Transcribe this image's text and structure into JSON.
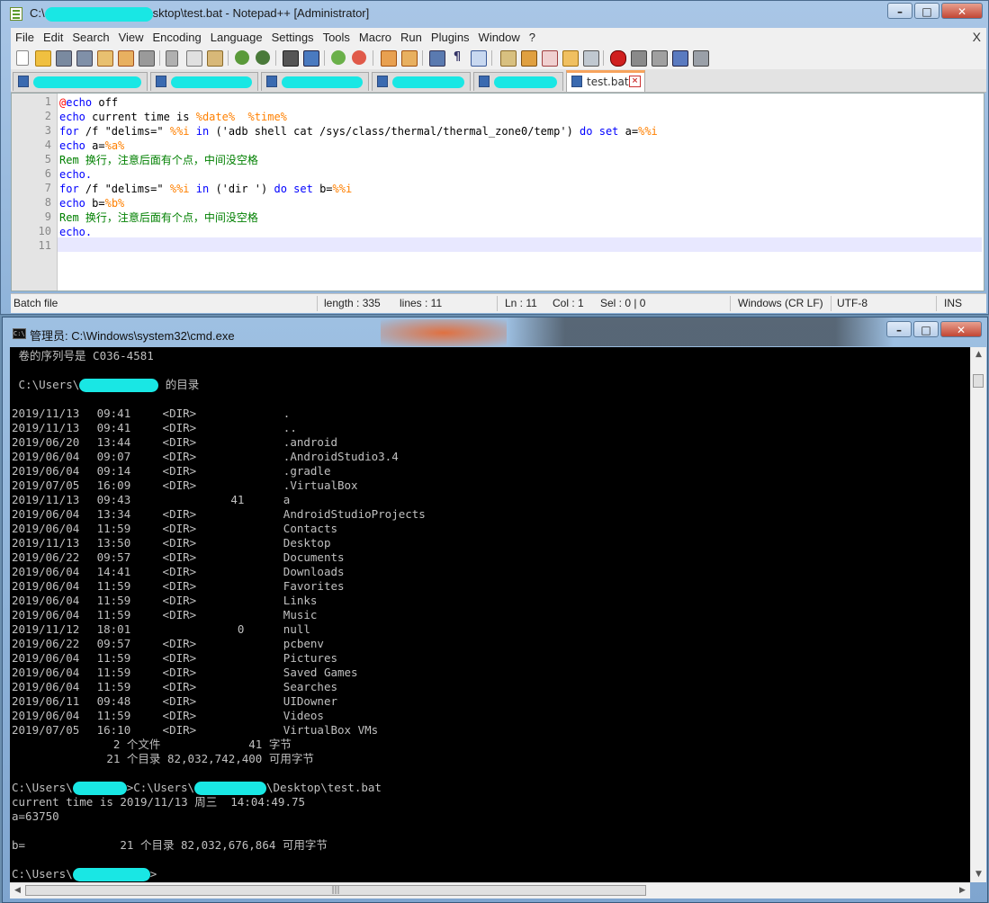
{
  "npp": {
    "title_prefix": "C:\\",
    "title_suffix": "sktop\\test.bat - Notepad++ [Administrator]",
    "menu": [
      "File",
      "Edit",
      "Search",
      "View",
      "Encoding",
      "Language",
      "Settings",
      "Tools",
      "Macro",
      "Run",
      "Plugins",
      "Window",
      "?"
    ],
    "menu_close": "X",
    "active_tab": "test.bat",
    "lines": [
      "1",
      "2",
      "3",
      "4",
      "5",
      "6",
      "7",
      "8",
      "9",
      "10",
      "11"
    ],
    "code": {
      "l1_at": "@",
      "l1_kw": "echo",
      "l1_rest": " off",
      "l2_kw": "echo",
      "l2_text": " current time is ",
      "l2_v1": "%date%",
      "l2_sp": "  ",
      "l2_v2": "%time%",
      "l3_kw1": "for",
      "l3_a": " /f \"delims=\" ",
      "l3_v1": "%%i",
      "l3_sp1": " ",
      "l3_kw2": "in",
      "l3_b": " ('adb shell cat /sys/class/thermal/thermal_zone0/temp') ",
      "l3_kw3": "do",
      "l3_sp2": " ",
      "l3_kw4": "set",
      "l3_c": " a=",
      "l3_v2": "%%i",
      "l4_kw": "echo",
      "l4_text": " a=",
      "l4_v": "%a%",
      "l5_rem": "Rem 换行，注意后面有个点，中间没空格",
      "l6_kw": "echo.",
      "l7_kw1": "for",
      "l7_a": " /f \"delims=\" ",
      "l7_v1": "%%i",
      "l7_sp1": " ",
      "l7_kw2": "in",
      "l7_b": " ('dir ') ",
      "l7_kw3": "do",
      "l7_sp2": " ",
      "l7_kw4": "set",
      "l7_c": " b=",
      "l7_v2": "%%i",
      "l8_kw": "echo",
      "l8_text": " b=",
      "l8_v": "%b%",
      "l9_rem": "Rem 换行，注意后面有个点，中间没空格",
      "l10_kw": "echo."
    },
    "status": {
      "type": "Batch file",
      "length": "length : 335",
      "lines": "lines : 11",
      "ln": "Ln : 11",
      "col": "Col : 1",
      "sel": "Sel : 0 | 0",
      "eol": "Windows (CR LF)",
      "enc": "UTF-8",
      "mode": "INS"
    }
  },
  "cmd": {
    "title": "管理员: C:\\Windows\\system32\\cmd.exe",
    "serial": " 卷的序列号是 C036-4581",
    "dir_prefix": " C:\\Users\\",
    "dir_suffix": " 的目录",
    "entries": [
      {
        "date": "2019/11/13",
        "time": "09:41",
        "type": "<DIR>",
        "size": "",
        "name": "."
      },
      {
        "date": "2019/11/13",
        "time": "09:41",
        "type": "<DIR>",
        "size": "",
        "name": ".."
      },
      {
        "date": "2019/06/20",
        "time": "13:44",
        "type": "<DIR>",
        "size": "",
        "name": ".android"
      },
      {
        "date": "2019/06/04",
        "time": "09:07",
        "type": "<DIR>",
        "size": "",
        "name": ".AndroidStudio3.4"
      },
      {
        "date": "2019/06/04",
        "time": "09:14",
        "type": "<DIR>",
        "size": "",
        "name": ".gradle"
      },
      {
        "date": "2019/07/05",
        "time": "16:09",
        "type": "<DIR>",
        "size": "",
        "name": ".VirtualBox"
      },
      {
        "date": "2019/11/13",
        "time": "09:43",
        "type": "",
        "size": "41",
        "name": "a"
      },
      {
        "date": "2019/06/04",
        "time": "13:34",
        "type": "<DIR>",
        "size": "",
        "name": "AndroidStudioProjects"
      },
      {
        "date": "2019/06/04",
        "time": "11:59",
        "type": "<DIR>",
        "size": "",
        "name": "Contacts"
      },
      {
        "date": "2019/11/13",
        "time": "13:50",
        "type": "<DIR>",
        "size": "",
        "name": "Desktop"
      },
      {
        "date": "2019/06/22",
        "time": "09:57",
        "type": "<DIR>",
        "size": "",
        "name": "Documents"
      },
      {
        "date": "2019/06/04",
        "time": "14:41",
        "type": "<DIR>",
        "size": "",
        "name": "Downloads"
      },
      {
        "date": "2019/06/04",
        "time": "11:59",
        "type": "<DIR>",
        "size": "",
        "name": "Favorites"
      },
      {
        "date": "2019/06/04",
        "time": "11:59",
        "type": "<DIR>",
        "size": "",
        "name": "Links"
      },
      {
        "date": "2019/06/04",
        "time": "11:59",
        "type": "<DIR>",
        "size": "",
        "name": "Music"
      },
      {
        "date": "2019/11/12",
        "time": "18:01",
        "type": "",
        "size": "0",
        "name": "null"
      },
      {
        "date": "2019/06/22",
        "time": "09:57",
        "type": "<DIR>",
        "size": "",
        "name": "pcbenv"
      },
      {
        "date": "2019/06/04",
        "time": "11:59",
        "type": "<DIR>",
        "size": "",
        "name": "Pictures"
      },
      {
        "date": "2019/06/04",
        "time": "11:59",
        "type": "<DIR>",
        "size": "",
        "name": "Saved Games"
      },
      {
        "date": "2019/06/04",
        "time": "11:59",
        "type": "<DIR>",
        "size": "",
        "name": "Searches"
      },
      {
        "date": "2019/06/11",
        "time": "09:48",
        "type": "<DIR>",
        "size": "",
        "name": "UIDowner"
      },
      {
        "date": "2019/06/04",
        "time": "11:59",
        "type": "<DIR>",
        "size": "",
        "name": "Videos"
      },
      {
        "date": "2019/07/05",
        "time": "16:10",
        "type": "<DIR>",
        "size": "",
        "name": "VirtualBox VMs"
      }
    ],
    "files_summary": "               2 个文件             41 字节",
    "dirs_summary": "              21 个目录 82,032,742,400 可用字节",
    "prompt1_a": "C:\\Users\\",
    "prompt1_b": ">C:\\Users\\",
    "prompt1_c": "\\Desktop\\test.bat",
    "out_time": "current time is 2019/11/13 周三  14:04:49.75",
    "out_a": "a=63750",
    "out_b": "b=              21 个目录 82,032,676,864 可用字节",
    "prompt2_a": "C:\\Users\\",
    "prompt2_b": ">"
  },
  "colors": {
    "keyword": "#0000ff",
    "variable": "#ff8000",
    "comment": "#008000",
    "redaction": "#19e7e4",
    "console_bg": "#000000",
    "console_fg": "#c0c0c0"
  },
  "icons": [
    "notepadpp-app-icon",
    "new-file-icon",
    "open-file-icon",
    "save-icon",
    "save-all-icon",
    "close-icon",
    "close-all-icon",
    "print-icon",
    "cut-icon",
    "copy-icon",
    "paste-icon",
    "undo-icon",
    "redo-icon",
    "find-icon",
    "replace-icon",
    "zoom-in-icon",
    "zoom-out-icon",
    "sync-v-icon",
    "sync-h-icon",
    "wrap-icon",
    "all-chars-icon",
    "indent-guide-icon",
    "lang-icon",
    "doc-map-icon",
    "func-list-icon",
    "folder-icon",
    "monitor-icon",
    "record-macro-icon",
    "stop-macro-icon",
    "play-macro-icon",
    "run-macro-icon",
    "save-macro-icon",
    "cmd-app-icon"
  ]
}
